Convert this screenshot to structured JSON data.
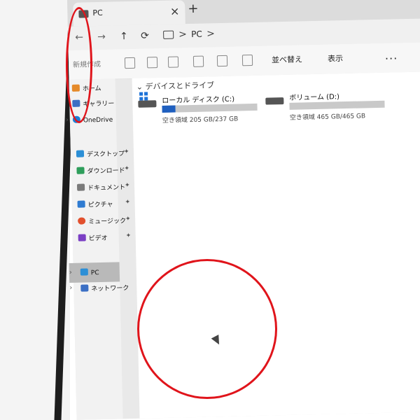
{
  "tab": {
    "title": "PC",
    "close": "×"
  },
  "new_tab": "+",
  "address": {
    "back": "←",
    "forward": "→",
    "up": "↑",
    "refresh": "⟳",
    "sep1": ">",
    "path": "PC",
    "sep2": ">"
  },
  "toolbar": {
    "new_label": "新規作成",
    "sort_label": "並べ替え",
    "view_label": "表示",
    "more_label": "..."
  },
  "sidebar": {
    "home": "ホーム",
    "gallery": "ギャラリー",
    "onedrive": "OneDrive",
    "desktop": "デスクトップ",
    "downloads": "ダウンロード",
    "documents": "ドキュメント",
    "pictures": "ピクチャ",
    "music": "ミュージック",
    "videos": "ビデオ",
    "pc": "PC",
    "network": "ネットワーク"
  },
  "main": {
    "group_header": "デバイスとドライブ",
    "drives": [
      {
        "name": "ローカル ディスク (C:)",
        "free": "空き領域 205 GB/237 GB",
        "used_fraction": 0.14
      },
      {
        "name": "ボリューム (D:)",
        "free": "空き領域 465 GB/465 GB",
        "used_fraction": 0.0
      }
    ]
  },
  "colors": {
    "annotation": "#e0141b",
    "drive_bar": "#1f5fbf"
  }
}
